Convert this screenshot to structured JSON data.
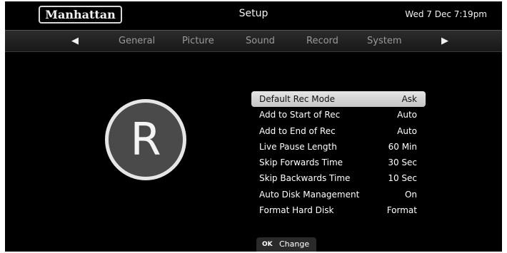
{
  "header": {
    "logo_text": "Manhattan",
    "title": "Setup",
    "datetime": "Wed 7 Dec 7:19pm"
  },
  "tabs": {
    "left_arrow": "◀",
    "right_arrow": "▶",
    "items": [
      {
        "label": "General"
      },
      {
        "label": "Picture"
      },
      {
        "label": "Sound"
      },
      {
        "label": "Record"
      },
      {
        "label": "System"
      }
    ]
  },
  "record_icon": {
    "letter": "R"
  },
  "settings": {
    "selected_index": 0,
    "rows": [
      {
        "label": "Default Rec Mode",
        "value": "Ask"
      },
      {
        "label": "Add to Start of Rec",
        "value": "Auto"
      },
      {
        "label": "Add to End of Rec",
        "value": "Auto"
      },
      {
        "label": "Live Pause Length",
        "value": "60 Min"
      },
      {
        "label": "Skip Forwards Time",
        "value": "30 Sec"
      },
      {
        "label": "Skip Backwards Time",
        "value": "10 Sec"
      },
      {
        "label": "Auto Disk Management",
        "value": "On"
      },
      {
        "label": "Format Hard Disk",
        "value": "Format"
      }
    ]
  },
  "footer": {
    "ok_key": "OK",
    "ok_label": "Change"
  },
  "colors": {
    "background": "#000000",
    "highlight": "#d4d4d4",
    "text": "#ffffff",
    "tab_text": "#9a9a9a"
  }
}
